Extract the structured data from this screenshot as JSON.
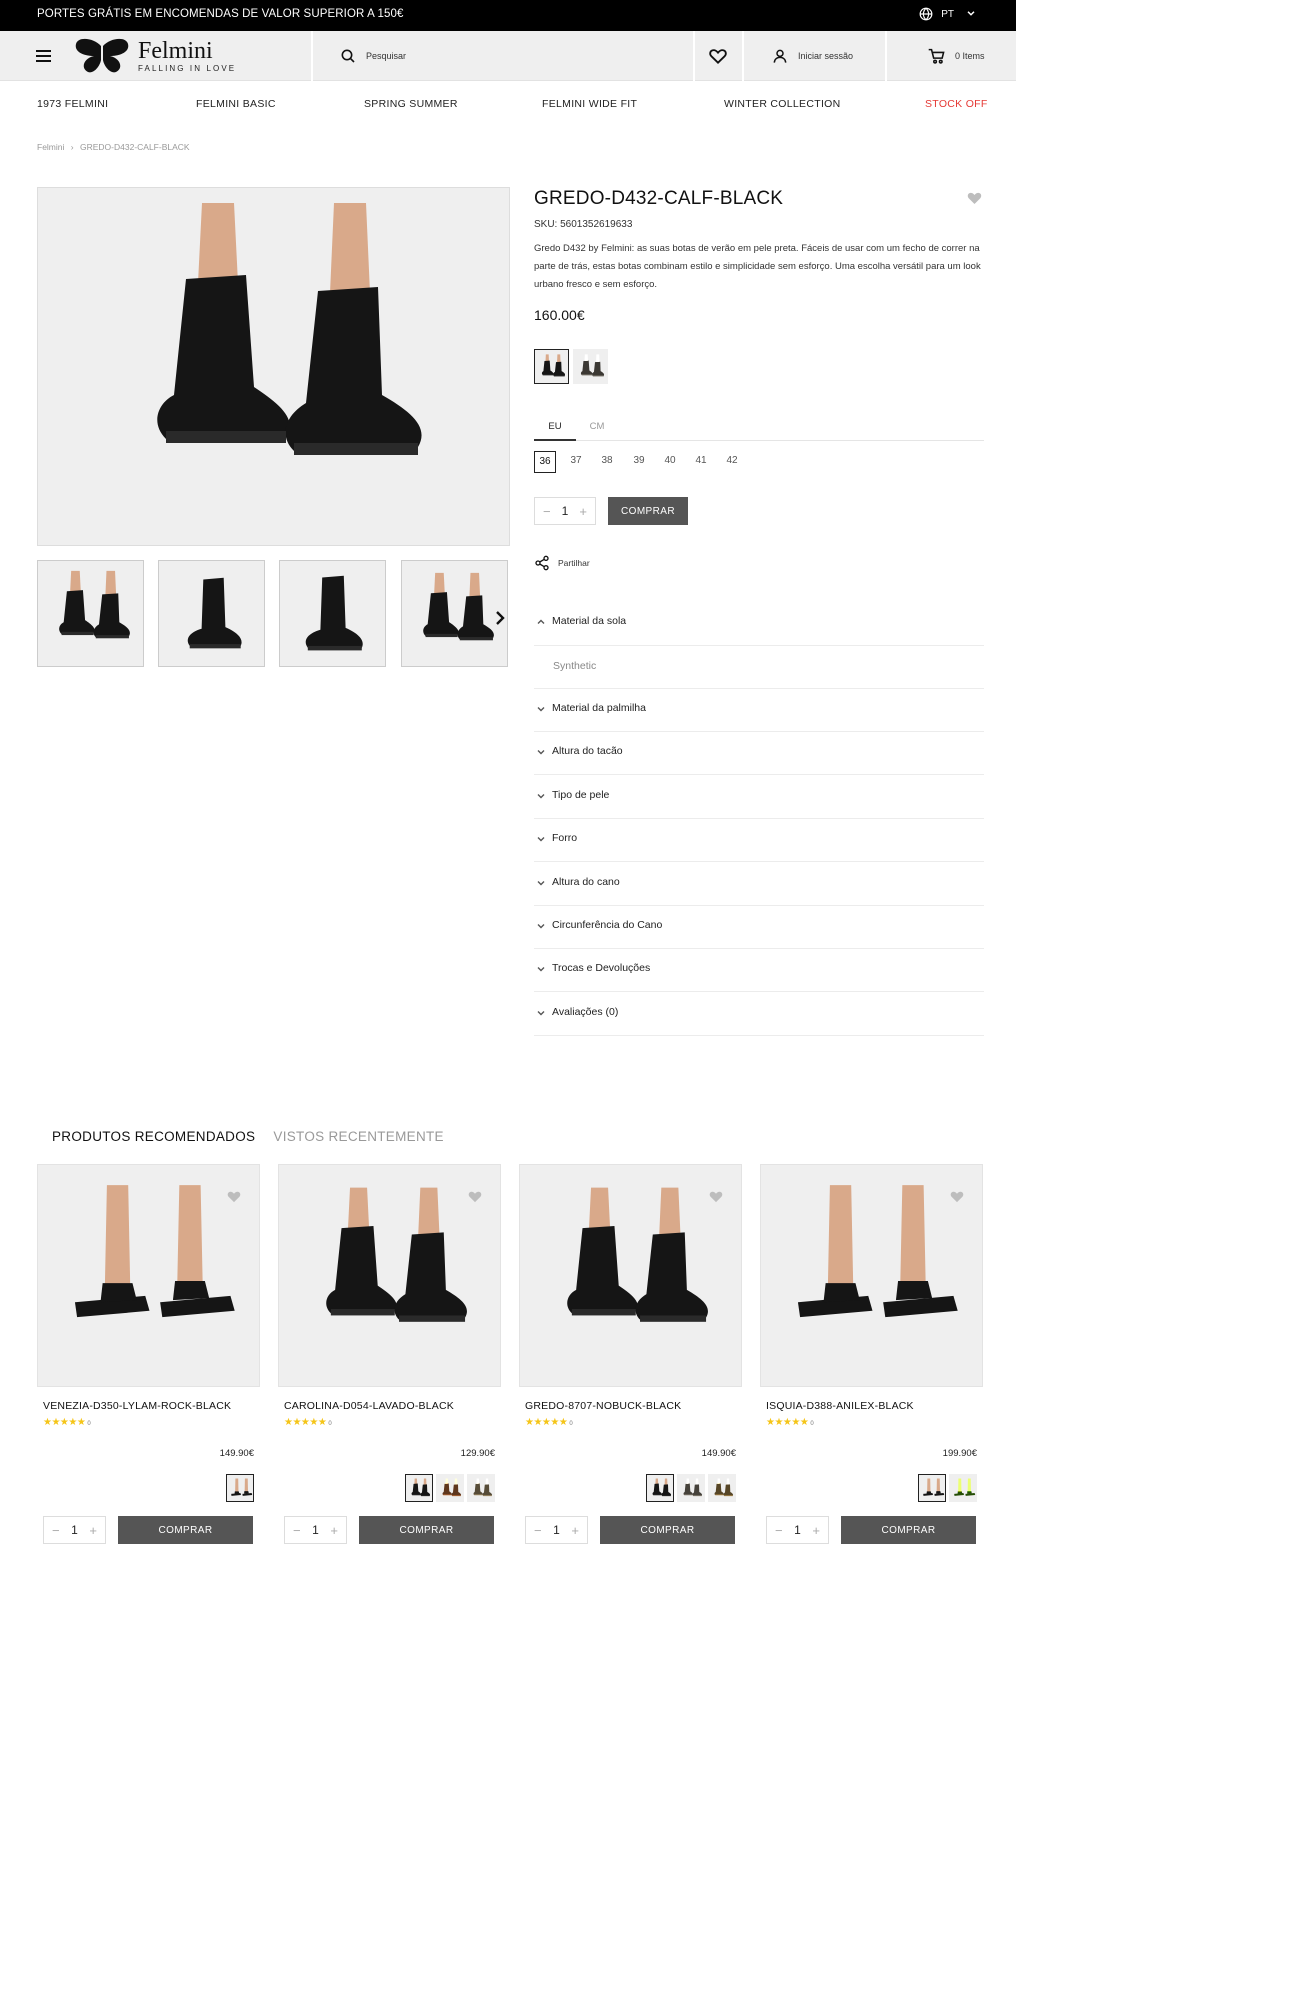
{
  "topbar": {
    "promo": "PORTES GRÁTIS EM ENCOMENDAS DE VALOR SUPERIOR A 150€",
    "lang": "PT"
  },
  "header": {
    "brand": "Felmini",
    "tagline": "FALLING IN LOVE",
    "search_label": "Pesquisar",
    "login_label": "Iniciar sessão",
    "cart_label": "0 Items"
  },
  "nav": [
    "1973 FELMINI",
    "FELMINI BASIC",
    "SPRING SUMMER",
    "FELMINI WIDE FIT",
    "WINTER COLLECTION",
    "STOCK OFF"
  ],
  "breadcrumb": {
    "home": "Felmini",
    "sep": "›",
    "current": "GREDO-D432-CALF-BLACK"
  },
  "product": {
    "title": "GREDO-D432-CALF-BLACK",
    "sku": "SKU: 5601352619633",
    "description": "Gredo D432 by Felmini: as suas botas de verão em pele preta. Fáceis de usar com um fecho de correr na parte de trás, estas botas combinam estilo e simplicidade sem esforço. Uma escolha versátil para um look urbano fresco e sem esforço.",
    "price": "160.00€",
    "size_tabs": [
      "EU",
      "CM"
    ],
    "sizes": [
      "36",
      "37",
      "38",
      "39",
      "40",
      "41",
      "42"
    ],
    "selected_size": "36",
    "quantity": "1",
    "buy_label": "COMPRAR",
    "share_label": "Partilhar"
  },
  "accordion": {
    "open_title": "Material da sola",
    "open_value": "Synthetic",
    "items": [
      "Material da palmilha",
      "Altura do tacão",
      "Tipo de pele",
      "Forro",
      "Altura do cano",
      "Circunferência do Cano",
      "Trocas e Devoluções",
      "Avaliações (0)"
    ]
  },
  "recommended": {
    "tab_active": "PRODUTOS RECOMENDADOS",
    "tab_inactive": "VISTOS RECENTEMENTE",
    "cards": [
      {
        "name": "VENEZIA-D350-LYLAM-ROCK-BLACK",
        "stars": "★★★★★",
        "reviews": "0",
        "price": "149.90€",
        "qty": "1",
        "buy": "COMPRAR"
      },
      {
        "name": "CAROLINA-D054-LAVADO-BLACK",
        "stars": "★★★★★",
        "reviews": "0",
        "price": "129.90€",
        "qty": "1",
        "buy": "COMPRAR"
      },
      {
        "name": "GREDO-8707-NOBUCK-BLACK",
        "stars": "★★★★★",
        "reviews": "0",
        "price": "149.90€",
        "qty": "1",
        "buy": "COMPRAR"
      },
      {
        "name": "ISQUIA-D388-ANILEX-BLACK",
        "stars": "★★★★★",
        "reviews": "0",
        "price": "199.90€",
        "qty": "1",
        "buy": "COMPRAR"
      }
    ]
  },
  "colors": {
    "accent_sale": "#e53935",
    "button": "#555555",
    "star": "#f5c518"
  }
}
